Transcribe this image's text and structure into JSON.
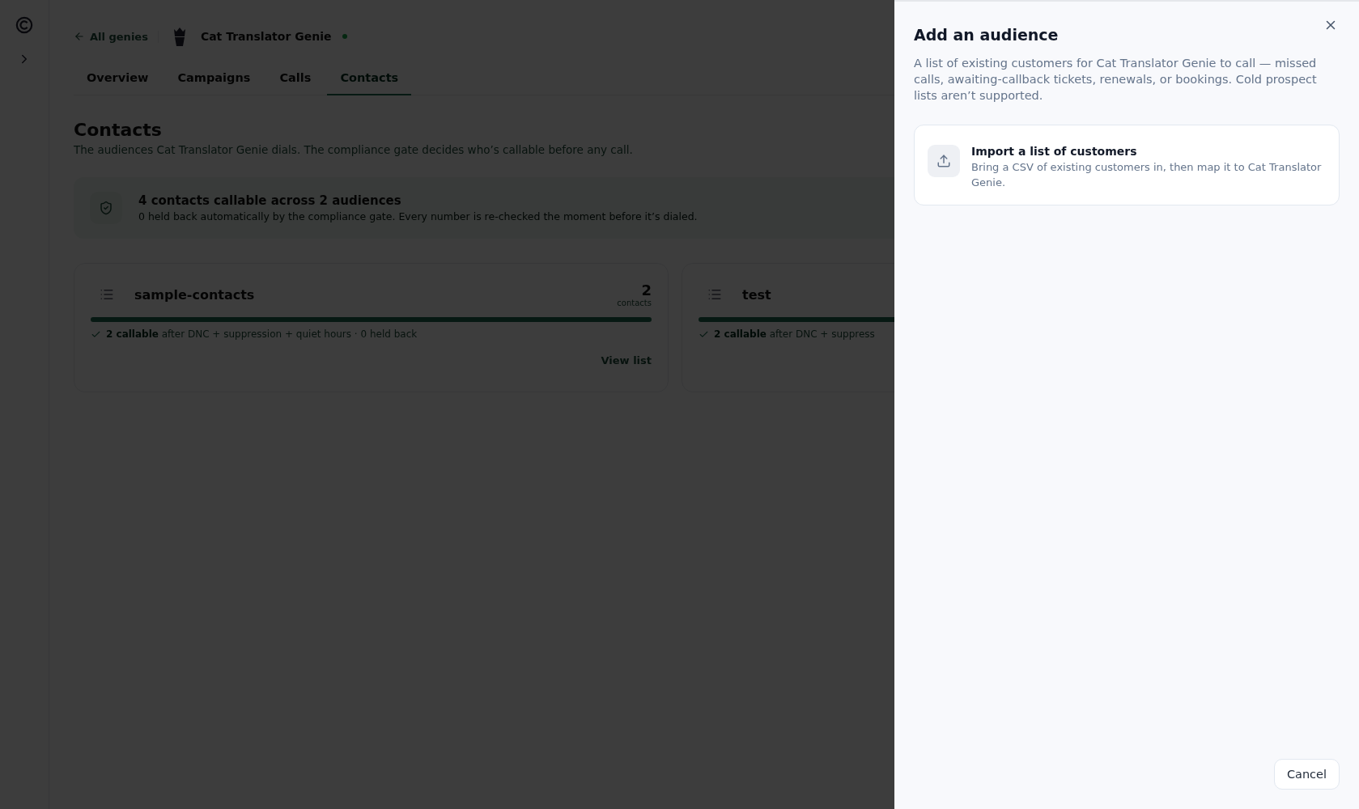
{
  "nav": {
    "back_link": "All genies",
    "genie_name": "Cat Translator Genie"
  },
  "tabs": [
    {
      "label": "Overview",
      "selected": false
    },
    {
      "label": "Campaigns",
      "selected": false
    },
    {
      "label": "Calls",
      "selected": false
    },
    {
      "label": "Contacts",
      "selected": true
    }
  ],
  "page": {
    "title": "Contacts",
    "subtitle": "The audiences Cat Translator Genie dials. The compliance gate decides who’s callable before any call."
  },
  "summary": {
    "title": "4 contacts callable across 2 audiences",
    "detail": "0 held back automatically by the compliance gate. Every number is re-checked the moment before it’s dialed."
  },
  "audiences": [
    {
      "name": "sample-contacts",
      "count": "2",
      "count_label": "contacts",
      "level": 1,
      "callable": "2 callable",
      "note": "after DNC + suppression + quiet hours · 0 held back",
      "link": "View list"
    },
    {
      "name": "test",
      "level": 1,
      "callable": "2 callable",
      "note": "after DNC + suppress"
    }
  ],
  "panel": {
    "title": "Add an audience",
    "description": "A list of existing customers for Cat Translator Genie to call — missed calls, awaiting-callback tickets, renewals, or bookings. Cold prospect lists aren’t supported.",
    "options": [
      {
        "title": "Import a list of customers",
        "description": "Bring a CSV of existing customers in, then map it to Cat Translator Genie."
      }
    ],
    "cancel": "Cancel"
  }
}
